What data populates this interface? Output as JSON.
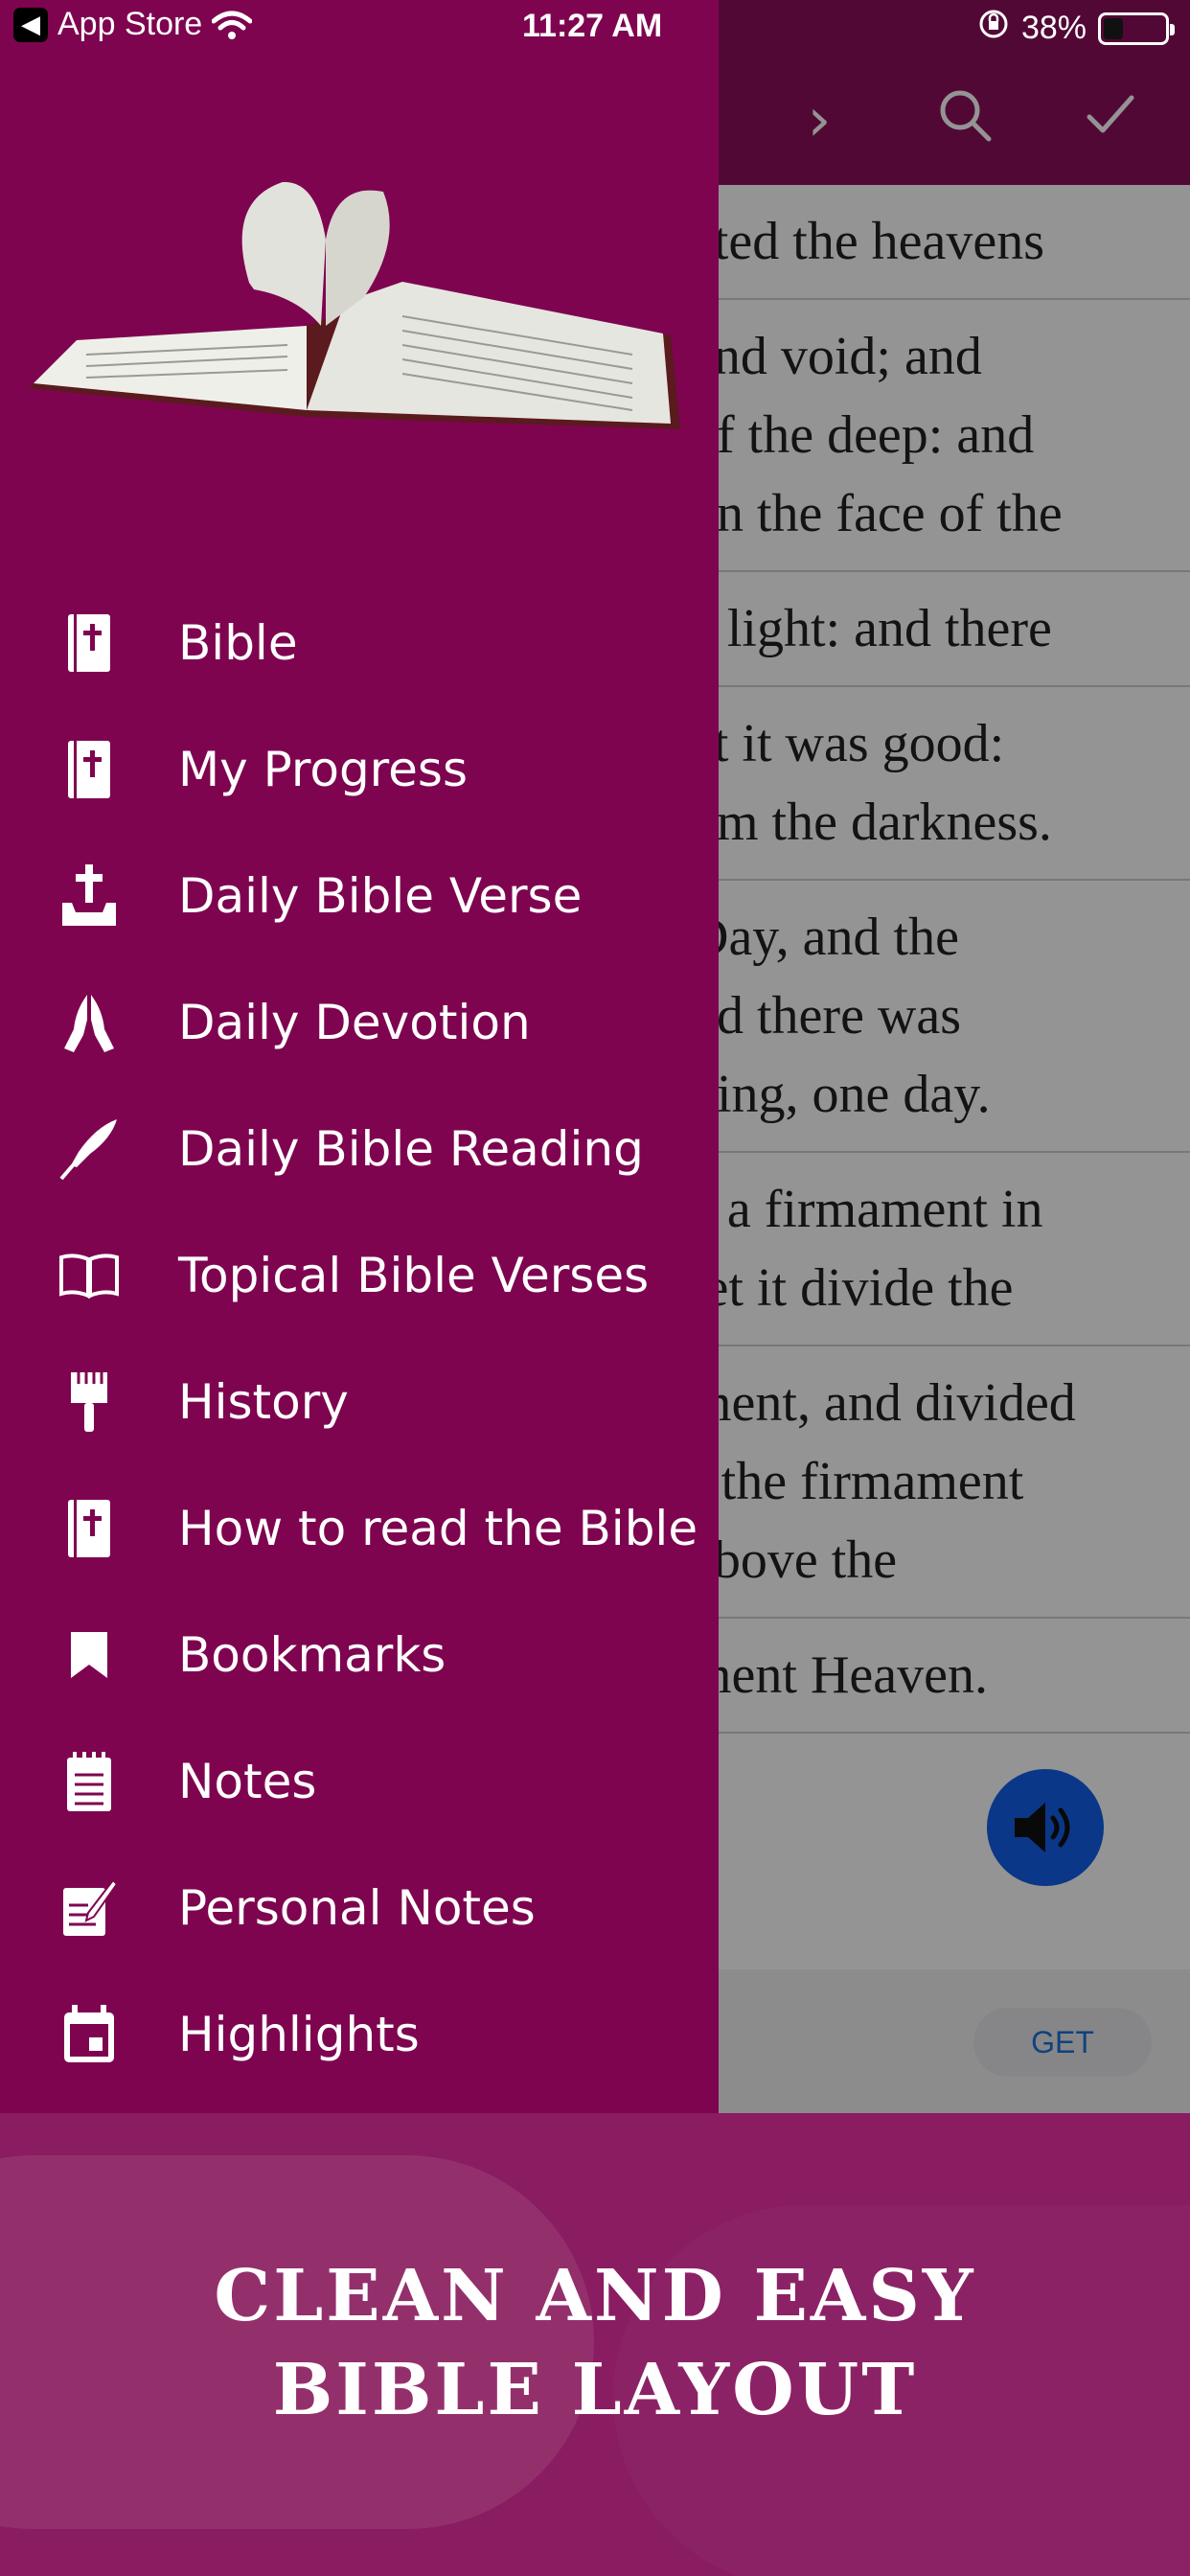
{
  "status_bar": {
    "back_label": "App Store",
    "time": "11:27 AM",
    "battery": "38%",
    "battery_level": 0.38
  },
  "background_app": {
    "header_icons": [
      "chevron-right-icon",
      "search-icon",
      "checkmark-icon"
    ],
    "verses": [
      [
        "ated the heavens"
      ],
      [
        "and void; and",
        "of the deep: and",
        "on the face of the"
      ],
      [
        "e light: and there"
      ],
      [
        "at it was good:",
        "om the darkness."
      ],
      [
        "Day, and the",
        "nd there was",
        "ning, one day."
      ],
      [
        "e a firmament in",
        " let it divide the"
      ],
      [
        "ment, and divided",
        "r the firmament",
        " above the"
      ],
      [
        "ment Heaven."
      ]
    ],
    "ad_button": "GET"
  },
  "drawer": {
    "items": [
      {
        "label": "Bible",
        "icon": "bible-icon"
      },
      {
        "label": "My Progress",
        "icon": "bible-icon"
      },
      {
        "label": "Daily Bible Verse",
        "icon": "cross-tray-icon"
      },
      {
        "label": "Daily Devotion",
        "icon": "praying-hands-icon"
      },
      {
        "label": "Daily Bible Reading",
        "icon": "quill-icon"
      },
      {
        "label": "Topical Bible Verses",
        "icon": "open-book-icon"
      },
      {
        "label": "History",
        "icon": "brush-icon"
      },
      {
        "label": "How to read the Bible",
        "icon": "bible-icon"
      },
      {
        "label": "Bookmarks",
        "icon": "bookmark-icon"
      },
      {
        "label": "Notes",
        "icon": "notepad-icon"
      },
      {
        "label": "Personal Notes",
        "icon": "edit-note-icon"
      },
      {
        "label": "Highlights",
        "icon": "calendar-icon"
      }
    ]
  },
  "promo": {
    "line1": "CLEAN AND EASY",
    "line2": "BIBLE LAYOUT"
  },
  "colors": {
    "drawer": "#7e0450",
    "promo": "#8a1c62",
    "audio": "#1260e8"
  }
}
